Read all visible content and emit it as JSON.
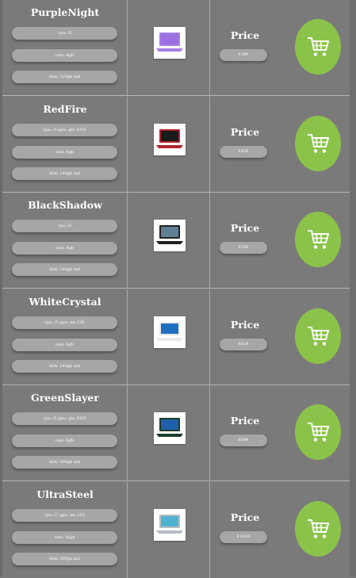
{
  "products": [
    {
      "name": "PurpleNight",
      "specs": [
        "cpu: i5",
        "ram: 4gb",
        "disk: 320gb ssd"
      ],
      "price_label": "Price",
      "price": "€399",
      "screen_color": "#9b6fe0",
      "body_color": "#a77de8",
      "thumb_icon": "laptop-purple-icon"
    },
    {
      "name": "RedFire",
      "specs": [
        "cpu: i5 gpu: gtx 1030",
        "ram: 8gb",
        "disk: 240gb ssd"
      ],
      "price_label": "Price",
      "price": "€459",
      "screen_color": "#1a1a1a",
      "body_color": "#b0252d",
      "thumb_icon": "laptop-red-icon"
    },
    {
      "name": "BlackShadow",
      "specs": [
        "cpu: i5",
        "ram: 4gb",
        "disk: 240gb ssd"
      ],
      "price_label": "Price",
      "price": "€599",
      "screen_color": "#5f7f92",
      "body_color": "#222222",
      "thumb_icon": "laptop-black-icon"
    },
    {
      "name": "WhiteCrystal",
      "specs": [
        "cpu: i5 gpu: mx 230",
        "ram: 8gb",
        "disk: 240gb ssd"
      ],
      "price_label": "Price",
      "price": "€629",
      "screen_color": "#1f6fc0",
      "body_color": "#e8e8e8",
      "thumb_icon": "laptop-white-icon"
    },
    {
      "name": "GreenSlayer",
      "specs": [
        "cpu: i5 gpu: gtx 1050",
        "ram: 8gb",
        "disk: 500gb ssd"
      ],
      "price_label": "Price",
      "price": "€899",
      "screen_color": "#1d5fa8",
      "body_color": "#1f3d2c",
      "thumb_icon": "laptop-green-icon"
    },
    {
      "name": "UltraSteel",
      "specs": [
        "cpu: i7 gpu: mx 250",
        "ram: 16gb",
        "disk: 500gb m2"
      ],
      "price_label": "Price",
      "price": "€1049",
      "screen_color": "#4fb3d0",
      "body_color": "#b8bcc2",
      "thumb_icon": "laptop-steel-icon"
    }
  ],
  "cart_icon": "shopping-cart-icon",
  "colors": {
    "background": "#7a7a7a",
    "pill": "#a6a6a6",
    "cart_button": "#8bc34a",
    "text": "#ffffff"
  }
}
